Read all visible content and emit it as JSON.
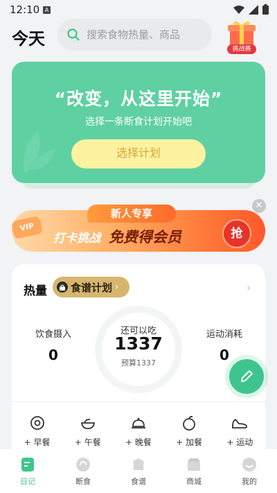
{
  "status": {
    "time": "12:10",
    "indicator": "A"
  },
  "header": {
    "title": "今天",
    "search_placeholder": "搜索食物热量、商品",
    "challenge_label": "挑战赛"
  },
  "hero": {
    "quote": "“改变，从这里开始”",
    "subtitle": "选择一条断食计划开始吧",
    "button": "选择计划"
  },
  "promo": {
    "tag": "新人专享",
    "vip": "VIP",
    "text1": "打卡挑战",
    "text2": "免费得会员",
    "grab": "抢"
  },
  "calories": {
    "title": "热量",
    "recipe": "食谱计划",
    "intake_label": "饮食摄入",
    "intake_value": "0",
    "remaining_label": "还可以吃",
    "remaining_value": "1337",
    "budget": "预算1337",
    "burn_label": "运动消耗",
    "burn_value": "0",
    "meals": [
      {
        "label": "+ 早餐",
        "icon": "breakfast-icon"
      },
      {
        "label": "+ 午餐",
        "icon": "lunch-icon"
      },
      {
        "label": "+ 晚餐",
        "icon": "dinner-icon"
      },
      {
        "label": "+ 加餐",
        "icon": "snack-icon"
      },
      {
        "label": "+ 运动",
        "icon": "exercise-icon"
      }
    ]
  },
  "nav": [
    {
      "label": "日记",
      "icon": "diary-icon",
      "active": true
    },
    {
      "label": "断食",
      "icon": "fasting-icon"
    },
    {
      "label": "食谱",
      "icon": "recipe-icon"
    },
    {
      "label": "商城",
      "icon": "mall-icon"
    },
    {
      "label": "我的",
      "icon": "profile-icon"
    }
  ],
  "colors": {
    "accent": "#3ec58d",
    "hero": "#5fd0a2",
    "button": "#fdf2a0",
    "recipe_pill": "#d6b66e"
  }
}
